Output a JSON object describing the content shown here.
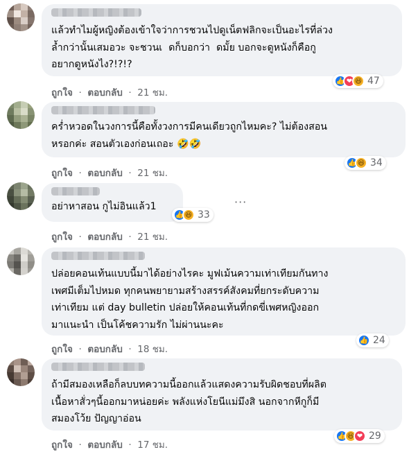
{
  "colors": {
    "like": "#1877f2",
    "love": "#f33e58",
    "haha": "#f7b125",
    "meta": "#65676b",
    "bubble": "#f0f2f5"
  },
  "comments": [
    {
      "lines": [
        "แล้วทำไมผู้หญิงต้องเข้าใจว่าการชวนไปดูเน็ตฟลิกจะเป็นอะไรที่ล่วง",
        "ล้ำกว่านั้นเสมอวะ จะชวนเ  ดก็บอกว่า  ดมั้ย บอกจะดูหนังก็คือกู",
        "อยากดูหนังไง?!?!?"
      ],
      "reactions": [
        "like-icon",
        "love-icon",
        "haha-icon"
      ],
      "count": "47",
      "like_label": "ถูกใจ",
      "reply_label": "ตอบกลับ",
      "time": "21 ชม."
    },
    {
      "lines": [
        "คร่ำหวอดในวงการนี้คือทั้งวงการมีคนเดียวถูกไหมคะ? ไม่ต้องสอน",
        "หรอกค่ะ สอนตัวเองก่อนเถอะ 🤣🤣"
      ],
      "reactions": [
        "like-icon",
        "haha-icon"
      ],
      "count": "34",
      "like_label": "ถูกใจ",
      "reply_label": "ตอบกลับ",
      "time": "21 ชม."
    },
    {
      "lines": [
        "อย่าหาสอน กูไม่อินแล้ว1"
      ],
      "reactions": [
        "like-icon",
        "haha-icon"
      ],
      "count": "33",
      "like_label": "ถูกใจ",
      "reply_label": "ตอบกลับ",
      "time": "21 ชม."
    },
    {
      "lines": [
        "ปล่อยคอนเท้นแบบนี้มาได้อย่างไรคะ มูฟเม้นความเท่าเทียมกันทาง",
        "เพศมีเต็มไปหมด ทุกคนพยายามสร้างสรรค์สังคมที่ยกระดับความ",
        "เท่าเทียม แต่ day bulletin ปล่อยให้คอนเท้นที่กดขี่เพศหญิงออก",
        "มาแนะนำ เป็นโค้ชความรัก ไม่ผ่านนะคะ"
      ],
      "reactions": [
        "like-icon"
      ],
      "count": "24",
      "like_label": "ถูกใจ",
      "reply_label": "ตอบกลับ",
      "time": "18 ชม."
    },
    {
      "lines": [
        "ถ้ามีสมองเหลือก็ลบบทความนี้ออกแล้วแสดงความรับผิดชอบที่ผลิต",
        "เนื้อหาสั่วๆนี้ออกมาหน่อยค่ะ พลังแห่งโยนีแม่มึงสิ นอกจากหีกูก็มี",
        "สมองโว้ย ปัญญาอ่อน"
      ],
      "reactions": [
        "like-icon",
        "haha-icon",
        "love-icon"
      ],
      "count": "29",
      "like_label": "ถูกใจ",
      "reply_label": "ตอบกลับ",
      "time": "17 ชม."
    }
  ]
}
